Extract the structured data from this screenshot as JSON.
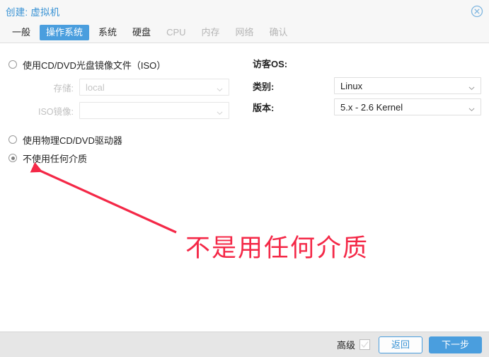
{
  "window": {
    "title": "创建: 虚拟机",
    "close_icon": "close-circle-icon"
  },
  "tabs": [
    {
      "label": "一般",
      "state": "normal"
    },
    {
      "label": "操作系统",
      "state": "active"
    },
    {
      "label": "系统",
      "state": "normal"
    },
    {
      "label": "硬盘",
      "state": "normal"
    },
    {
      "label": "CPU",
      "state": "disabled"
    },
    {
      "label": "内存",
      "state": "disabled"
    },
    {
      "label": "网络",
      "state": "disabled"
    },
    {
      "label": "确认",
      "state": "disabled"
    }
  ],
  "media": {
    "options": [
      {
        "label": "使用CD/DVD光盘镜像文件（ISO）",
        "selected": false
      },
      {
        "label": "使用物理CD/DVD驱动器",
        "selected": false
      },
      {
        "label": "不使用任何介质",
        "selected": true
      }
    ],
    "storage_label": "存储:",
    "storage_value": "local",
    "iso_label": "ISO镜像:",
    "iso_value": ""
  },
  "guest_os": {
    "title": "访客OS:",
    "type_label": "类别:",
    "type_value": "Linux",
    "version_label": "版本:",
    "version_value": "5.x - 2.6 Kernel"
  },
  "footer": {
    "advanced_label": "高级",
    "back_label": "返回",
    "next_label": "下一步"
  },
  "annotation": {
    "text": "不是用任何介质",
    "color": "#f42847"
  },
  "colors": {
    "accent": "#4a9ede",
    "title": "#3892d4",
    "annotation": "#f42847",
    "footer_bg": "#e6e6e6"
  }
}
